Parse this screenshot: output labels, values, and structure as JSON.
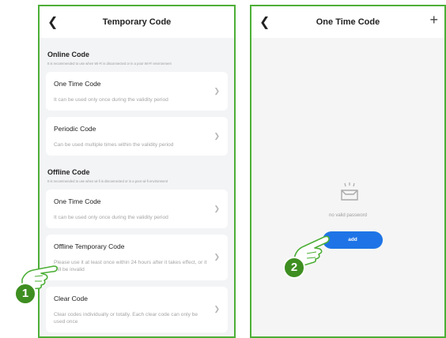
{
  "left_screen": {
    "title": "Temporary Code",
    "online_section": {
      "title": "Online Code",
      "note": "It is recommended to use when Wi-Fi is disconnected or in a poor Wi-Fi environment",
      "items": [
        {
          "label": "One Time Code",
          "desc": "It can be used only once during the validity period"
        },
        {
          "label": "Periodic Code",
          "desc": "Can be used multiple times within the validity period"
        }
      ]
    },
    "offline_section": {
      "title": "Offline Code",
      "note": "It is recommended to use when wi-fi is disconnected or in a poor wi-fi environment",
      "items": [
        {
          "label": "One Time Code",
          "desc": "It can be used only once during the validity period"
        },
        {
          "label": "Offline Temporary Code",
          "desc": "Please use it at least once within 24 hours after it takes effect, or it will be invalid"
        },
        {
          "label": "Clear Code",
          "desc": "Clear codes individually or totally. Each clear code can only be used once"
        }
      ]
    }
  },
  "right_screen": {
    "title": "One Time Code",
    "empty_text": "no valid password",
    "add_label": "add"
  },
  "annotations": {
    "step1": "1",
    "step2": "2"
  },
  "colors": {
    "frame_border": "#4caf36",
    "step_badge": "#3e8e21",
    "add_button": "#1e74e6"
  },
  "icons": {
    "back": "back-arrow-icon",
    "chevron": "chevron-right-icon",
    "add": "plus-icon",
    "empty": "empty-inbox-icon",
    "pointer": "pointing-hand-icon"
  }
}
